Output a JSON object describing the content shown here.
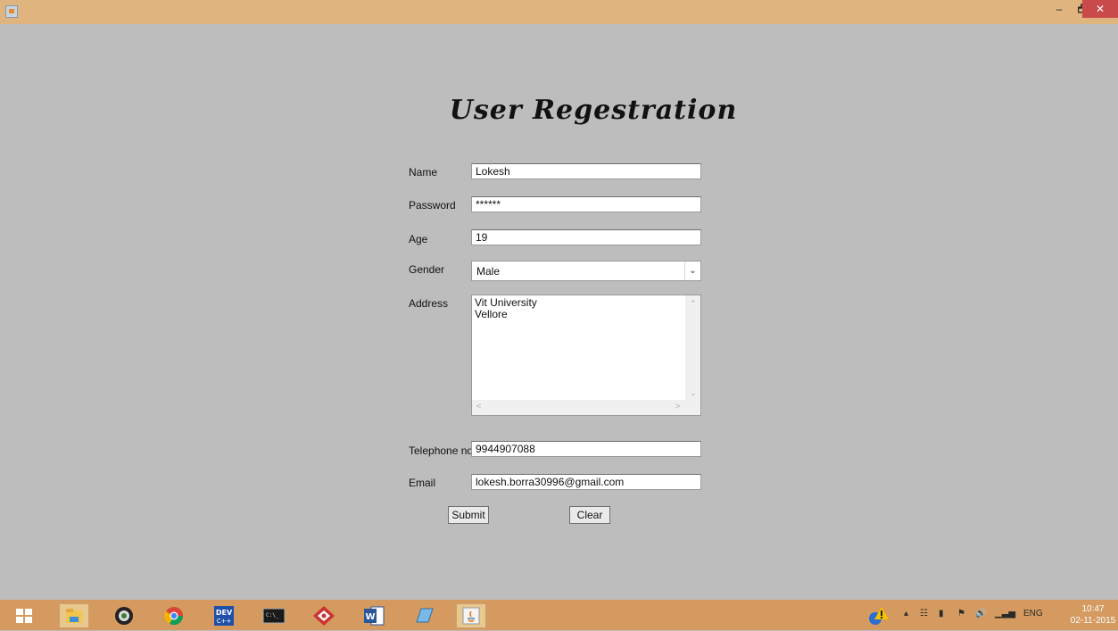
{
  "window": {
    "minimize_label": "–",
    "maximize_label": "🗗",
    "close_label": "✕"
  },
  "form": {
    "title": "User Regestration",
    "fields": {
      "name": {
        "label": "Name",
        "value": "Lokesh"
      },
      "password": {
        "label": "Password",
        "value": "******"
      },
      "age": {
        "label": "Age",
        "value": "19"
      },
      "gender": {
        "label": "Gender",
        "value": "Male"
      },
      "address": {
        "label": "Address",
        "value": "Vit University\nVellore"
      },
      "telephone": {
        "label": "Telephone no",
        "value": "9944907088"
      },
      "email": {
        "label": "Email",
        "value": "lokesh.borra30996@gmail.com"
      }
    },
    "submit_label": "Submit",
    "clear_label": "Clear"
  },
  "taskbar": {
    "items": [
      "start-icon",
      "file-explorer-icon",
      "camera-icon",
      "chrome-icon",
      "dev-icon",
      "cmd-icon",
      "app-icon",
      "word-icon",
      "notepad-icon",
      "java-icon"
    ],
    "tray": {
      "language": "ENG",
      "time": "10:47",
      "date": "02-11-2015"
    }
  },
  "colors": {
    "titlebar": "#dfb47f",
    "background": "#bdbdbd",
    "taskbar": "#d49a5f"
  }
}
